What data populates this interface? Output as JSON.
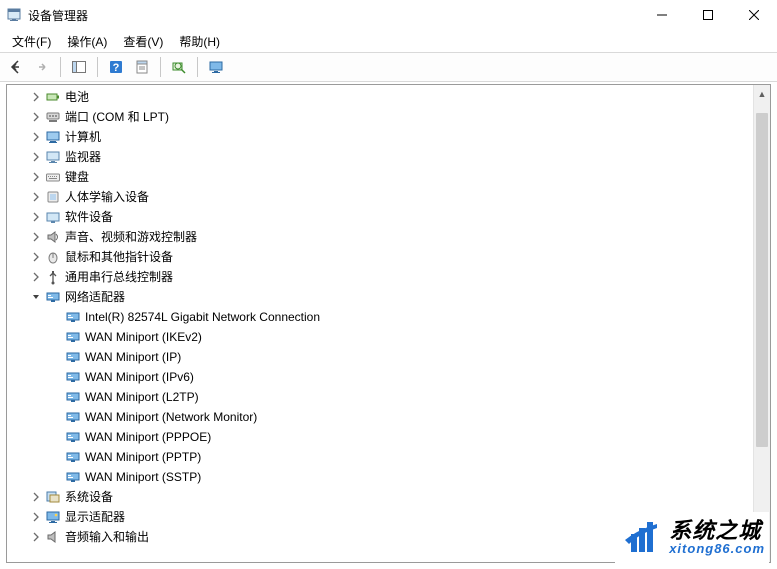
{
  "window": {
    "title": "设备管理器"
  },
  "menu": {
    "file": "文件(F)",
    "action": "操作(A)",
    "view": "查看(V)",
    "help": "帮助(H)"
  },
  "toolbar_icons": {
    "back": "back-arrow",
    "forward": "forward-arrow",
    "show_hide": "show-hide-console-tree",
    "help2": "help-question",
    "properties": "properties-sheet",
    "scan": "scan-hardware",
    "devices_view": "devices-monitor"
  },
  "tree": {
    "top": [
      {
        "label": "电池",
        "icon": "battery"
      },
      {
        "label": "端口 (COM 和 LPT)",
        "icon": "port"
      },
      {
        "label": "计算机",
        "icon": "computer"
      },
      {
        "label": "监视器",
        "icon": "monitor"
      },
      {
        "label": "键盘",
        "icon": "keyboard"
      },
      {
        "label": "人体学输入设备",
        "icon": "hid"
      },
      {
        "label": "软件设备",
        "icon": "software"
      },
      {
        "label": "声音、视频和游戏控制器",
        "icon": "sound"
      },
      {
        "label": "鼠标和其他指针设备",
        "icon": "mouse"
      },
      {
        "label": "通用串行总线控制器",
        "icon": "usb"
      }
    ],
    "network": {
      "label": "网络适配器",
      "children": [
        "Intel(R) 82574L Gigabit Network Connection",
        "WAN Miniport (IKEv2)",
        "WAN Miniport (IP)",
        "WAN Miniport (IPv6)",
        "WAN Miniport (L2TP)",
        "WAN Miniport (Network Monitor)",
        "WAN Miniport (PPPOE)",
        "WAN Miniport (PPTP)",
        "WAN Miniport (SSTP)"
      ]
    },
    "bottom": [
      {
        "label": "系统设备",
        "icon": "system"
      },
      {
        "label": "显示适配器",
        "icon": "display"
      },
      {
        "label": "音频输入和输出",
        "icon": "audio_io"
      }
    ]
  },
  "watermark": {
    "title": "系统之城",
    "url": "xitong86.com"
  }
}
